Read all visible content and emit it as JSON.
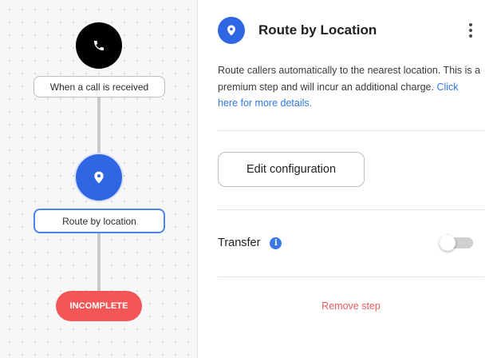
{
  "canvas": {
    "trigger_node": {
      "icon": "phone-icon",
      "label": "When a call is received"
    },
    "route_node": {
      "icon": "location-pin-icon",
      "label": "Route by location",
      "selected": true
    },
    "status_pill": {
      "label": "INCOMPLETE",
      "color": "#f35656"
    }
  },
  "panel": {
    "icon": "location-pin-icon",
    "title": "Route by Location",
    "menu_icon": "kebab-menu-icon",
    "description": {
      "text": "Route callers automatically to the nearest location. This is a premium step and will incur an additional charge. ",
      "link": "Click here for more details."
    },
    "edit_button": "Edit configuration",
    "transfer": {
      "label": "Transfer",
      "info_icon": "info-icon",
      "info_glyph": "i",
      "enabled": false
    },
    "remove_step": "Remove step"
  },
  "colors": {
    "accent": "#2f66e3",
    "link": "#2f78e6",
    "danger": "#ef5b5b"
  }
}
